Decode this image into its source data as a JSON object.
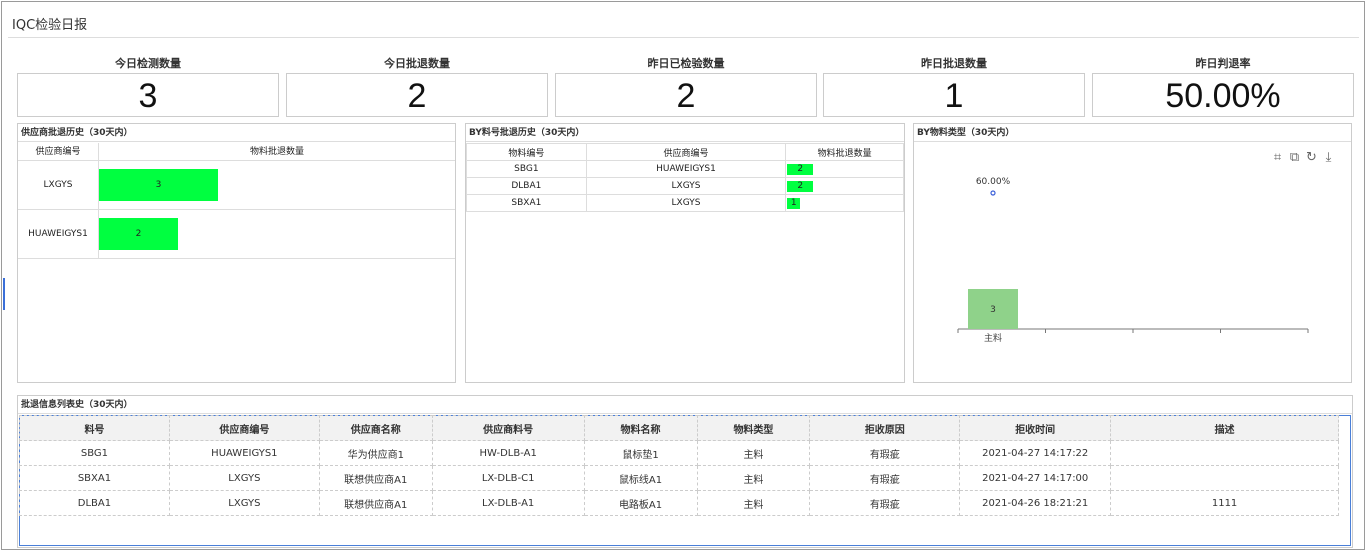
{
  "page": {
    "title": "IQC检验日报"
  },
  "kpis": [
    {
      "label": "今日检测数量",
      "value": "3"
    },
    {
      "label": "今日批退数量",
      "value": "2"
    },
    {
      "label": "昨日已检验数量",
      "value": "2"
    },
    {
      "label": "昨日批退数量",
      "value": "1"
    },
    {
      "label": "昨日判退率",
      "value": "50.00%"
    }
  ],
  "supplier_history": {
    "title": "供应商批退历史（30天内）",
    "headers": [
      "供应商编号",
      "物料批退数量"
    ],
    "rows": [
      {
        "name": "LXGYS",
        "value": 3
      },
      {
        "name": "HUAWEIGYS1",
        "value": 2
      }
    ],
    "max": 3
  },
  "material_history": {
    "title": "BY料号批退历史（30天内）",
    "headers": [
      "物料编号",
      "供应商编号",
      "物料批退数量"
    ],
    "rows": [
      {
        "code": "SBG1",
        "supplier": "HUAWEIGYS1",
        "value": 2
      },
      {
        "code": "DLBA1",
        "supplier": "LXGYS",
        "value": 2
      },
      {
        "code": "SBXA1",
        "supplier": "LXGYS",
        "value": 1
      }
    ],
    "bar_color": "#00ff40"
  },
  "type_chart": {
    "title": "BY物料类型（30天内）",
    "toolbox": [
      "crop-icon",
      "restore-crop-icon",
      "refresh-icon",
      "download-icon"
    ]
  },
  "chart_data": {
    "type": "bar",
    "categories": [
      "主料",
      "",
      "",
      ""
    ],
    "values": [
      3,
      null,
      null,
      null
    ],
    "line_values": [
      60.0,
      null,
      null,
      null
    ],
    "line_label": "60.00%",
    "bar_color": "#8fd28a",
    "point_color": "#3a5fd8"
  },
  "reject_list": {
    "title": "批退信息列表史（30天内）",
    "headers": [
      "料号",
      "供应商编号",
      "供应商名称",
      "供应商料号",
      "物料名称",
      "物料类型",
      "拒收原因",
      "拒收时间",
      "描述"
    ],
    "rows": [
      [
        "SBG1",
        "HUAWEIGYS1",
        "华为供应商1",
        "HW-DLB-A1",
        "鼠标垫1",
        "主料",
        "有瑕疵",
        "2021-04-27 14:17:22",
        ""
      ],
      [
        "SBXA1",
        "LXGYS",
        "联想供应商A1",
        "LX-DLB-C1",
        "鼠标线A1",
        "主料",
        "有瑕疵",
        "2021-04-27 14:17:00",
        ""
      ],
      [
        "DLBA1",
        "LXGYS",
        "联想供应商A1",
        "LX-DLB-A1",
        "电路板A1",
        "主料",
        "有瑕疵",
        "2021-04-26 18:21:21",
        "1111"
      ]
    ]
  }
}
